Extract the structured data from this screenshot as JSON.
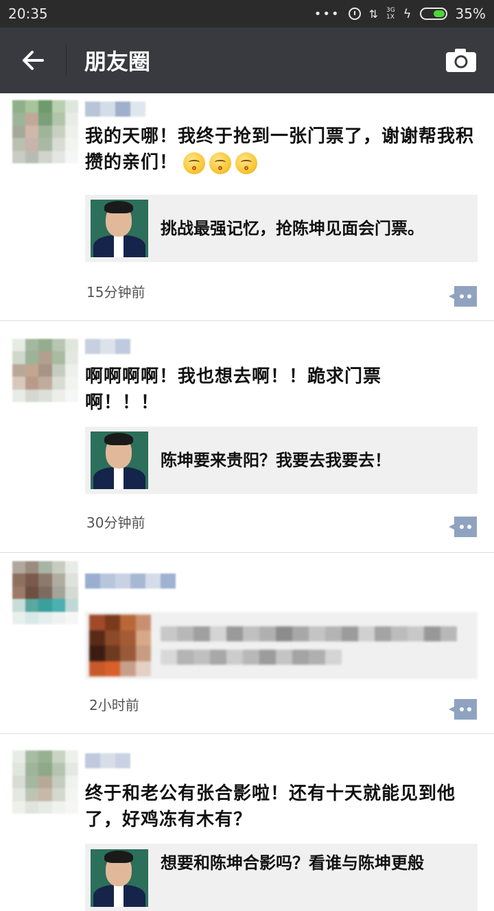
{
  "status_bar": {
    "time": "20:35",
    "dots": "•••",
    "network_top": "3G",
    "network_bottom": "1X",
    "battery_percent": "35%",
    "battery_level": 0.35
  },
  "header": {
    "title": "朋友圈",
    "back_icon": "back-arrow-icon",
    "camera_icon": "camera-icon",
    "background": "#393a3f"
  },
  "posts": [
    {
      "text": "我的天哪！我终于抢到一张门票了，谢谢帮我积攒的亲们！",
      "emoji_count": 3,
      "link_title": "挑战最强记忆，抢陈坤见面会门票。",
      "time": "15分钟前"
    },
    {
      "text": "啊啊啊啊！我也想去啊！！跪求门票啊！！！",
      "link_title": "陈坤要来贵阳？我要去我要去！",
      "time": "30分钟前"
    },
    {
      "text": "",
      "link_title": "",
      "time": "2小时前"
    },
    {
      "text": "终于和老公有张合影啦！还有十天就能见到他了，好鸡冻有木有？",
      "link_title": "想要和陈坤合影吗？看谁与陈坤更般",
      "time": ""
    }
  ],
  "colors": {
    "accent": "#393a3f",
    "comment_button": "#8fa3c0",
    "link_card_bg": "#f0f0f0"
  }
}
